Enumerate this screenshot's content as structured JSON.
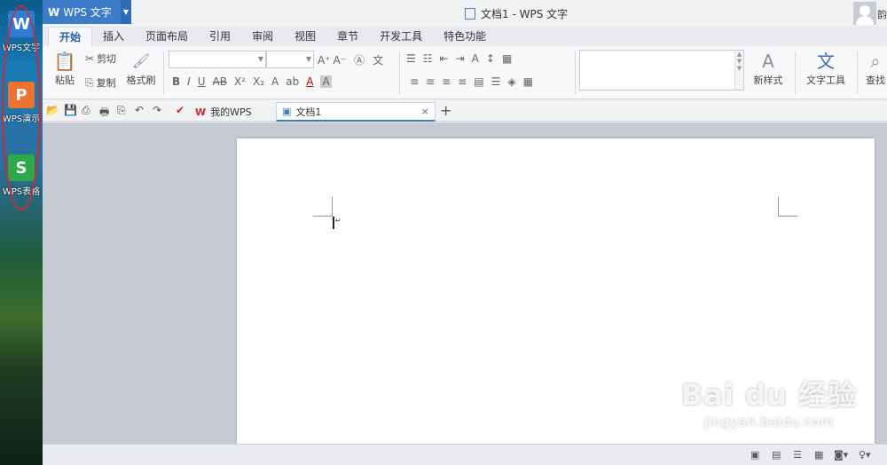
{
  "desktop": {
    "icons": [
      {
        "label": "WPS文字",
        "glyph": "W",
        "color": "#2f7bd6"
      },
      {
        "label": "WPS演示",
        "glyph": "P",
        "color": "#f0712b"
      },
      {
        "label": "WPS表格",
        "glyph": "S",
        "color": "#2caa47"
      }
    ]
  },
  "titlebar": {
    "app_menu_label": "WPS 文字",
    "app_logo": "W",
    "window_title": "文档1 - WPS 文字",
    "user_char": "韵"
  },
  "tabs": [
    "开始",
    "插入",
    "页面布局",
    "引用",
    "审阅",
    "视图",
    "章节",
    "开发工具",
    "特色功能"
  ],
  "ribbon": {
    "paste": "粘贴",
    "cut": "剪切",
    "copy": "复制",
    "format_painter": "格式刷",
    "new_style": "新样式",
    "text_tools": "文字工具",
    "find": "查找"
  },
  "doc_tabs": [
    {
      "label": "我的WPS",
      "close": "×"
    },
    {
      "label": "文档1",
      "close": "×"
    }
  ],
  "new_tab": "+",
  "watermark": {
    "main": "Bai du 经验",
    "sub": "jingyan.baidu.com"
  },
  "colors": {
    "accent": "#3d7cc9",
    "active_tab_text": "#2a5da8",
    "highlight_oval": "#d8262e"
  }
}
